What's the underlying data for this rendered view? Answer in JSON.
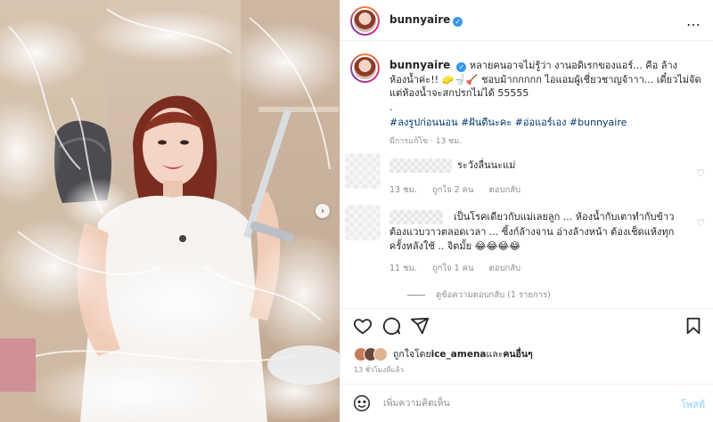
{
  "post": {
    "username": "bunnyaire",
    "verified_glyph": "✓",
    "more_icon": "…"
  },
  "caption": {
    "username": "bunnyaire",
    "text": "หลายคนอาจไม่รู้ว่า งานอดิเรกของแอร์... คือ ล้างห้องน้ำค่ะ!! 🧽🚽🪠 ชอบม้ากกกกก ไอแอมผู้เชี่ยวชาญจ้าาา... เดี๋ยวไม่จัดแต่ห้องน้ำจะสกปรกไม่ได้ 55555",
    "dot": ".",
    "hashtags": "#ลงรูปก่อนนอน #ฝันดีนะคะ #อ่อแอร์เอง #bunnyaire",
    "edited": "มีการแก้ไข · 13 ชม."
  },
  "comments": [
    {
      "text": "ระวังลื่นนะแม่",
      "time": "13 ชม.",
      "likes": "ถูกใจ 2 คน",
      "reply": "ตอบกลับ"
    },
    {
      "text": "เป็นโรคเดียวกับแม่เลยลูก ... ห้องน้ำกับเตาทำกับข้าว ต้องแวบวาวตลอดเวลา ... ซิ้งก์ล้างจาน อ่างล้างหน้า ต้องเช็ดแห้งทุกครั้งหลังใช้ .. จิตมั้ย 😂😂😂😂",
      "time": "11 ชม.",
      "likes": "ถูกใจ 1 คน",
      "reply": "ตอบกลับ"
    }
  ],
  "view_replies": "ดูข้อความตอบกลับ (1 รายการ)",
  "likes": {
    "prefix": "ถูกใจโดย ",
    "user": "ice_amena",
    "middle": " และ",
    "others": "คนอื่นๆ"
  },
  "time_ago": "13 ชั่วโมงที่แล้ว",
  "add_comment": {
    "placeholder": "เพิ่มความคิดเห็น",
    "post_label": "โพสต์"
  },
  "icons": {
    "like": "heart-icon",
    "comment": "comment-icon",
    "share": "share-icon",
    "save": "bookmark-icon",
    "emoji": "emoji-icon",
    "next": "chevron-right-icon"
  },
  "colors": {
    "link": "#00376b",
    "verified": "#3897f0",
    "muted": "#8e8e8e",
    "post_button": "#b2dffc"
  }
}
